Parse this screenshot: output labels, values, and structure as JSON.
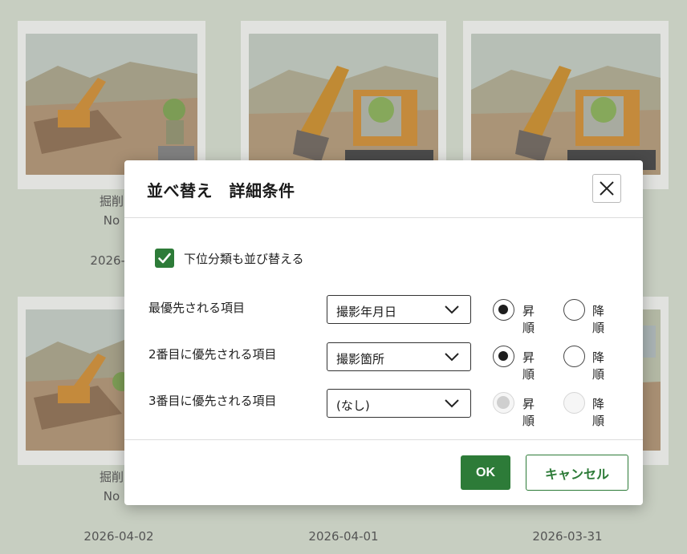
{
  "gallery": {
    "row1": [
      {
        "caption_line1": "掘削",
        "caption_line2": "No",
        "date": "2026-0"
      },
      {
        "caption_line1": "",
        "caption_line2": "",
        "date": ""
      },
      {
        "caption_line1": "",
        "caption_line2": "",
        "date": ""
      }
    ],
    "row2": [
      {
        "caption_line1": "掘削",
        "caption_line2": "No",
        "date": "2026-04-02"
      },
      {
        "caption_line1": "",
        "caption_line2": "",
        "date": "2026-04-01"
      },
      {
        "caption_line1": "",
        "caption_line2": "",
        "date": "2026-03-31"
      }
    ]
  },
  "dialog": {
    "title": "並べ替え　詳細条件",
    "close_icon": "close-icon",
    "include_subcategory": {
      "label": "下位分類も並び替える",
      "checked": true
    },
    "sort_rows": [
      {
        "label": "最優先される項目",
        "selected": "撮影年月日",
        "order": "asc",
        "disabled": false
      },
      {
        "label": "2番目に優先される項目",
        "selected": "撮影箇所",
        "order": "asc",
        "disabled": false
      },
      {
        "label": "3番目に優先される項目",
        "selected": "(なし)",
        "order": "asc",
        "disabled": true
      }
    ],
    "asc_label": "昇順",
    "desc_label": "降順",
    "ok_label": "OK",
    "cancel_label": "キャンセル"
  },
  "colors": {
    "accent": "#2d7b38",
    "overlay": "#c7cec1"
  }
}
